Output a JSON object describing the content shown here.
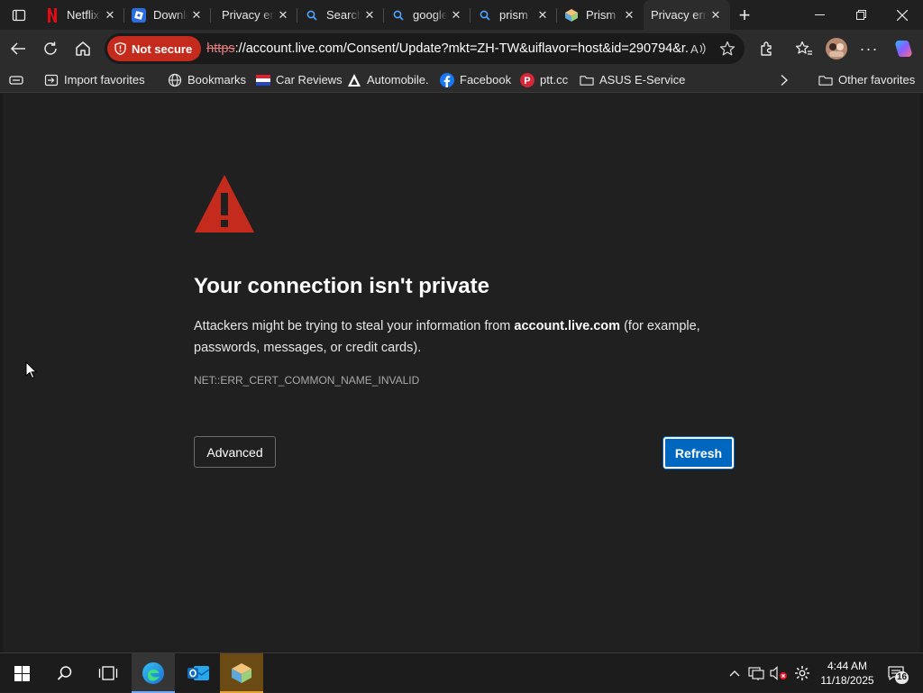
{
  "tabs": [
    {
      "title": "Netflix",
      "icon": "netflix-icon"
    },
    {
      "title": "Download",
      "icon": "roblox-icon"
    },
    {
      "title": "Privacy error",
      "icon": "none"
    },
    {
      "title": "Search",
      "icon": "search-icon"
    },
    {
      "title": "google",
      "icon": "search-icon"
    },
    {
      "title": "prism",
      "icon": "search-icon"
    },
    {
      "title": "Prism",
      "icon": "prism-icon"
    },
    {
      "title": "Privacy error",
      "icon": "none",
      "active": true
    }
  ],
  "toolbar": {
    "security_label": "Not secure",
    "url_scheme": "https",
    "url_rest": "://account.live.com/Consent/Update?mkt=ZH-TW&uiflavor=host&id=290794&r..."
  },
  "favorites": {
    "items": [
      {
        "label": "Import favorites",
        "icon": "import-icon"
      },
      {
        "label": "Bookmarks",
        "icon": "globe-icon"
      },
      {
        "label": "Car Reviews",
        "icon": "flag-icon"
      },
      {
        "label": "Automobile.",
        "icon": "automobile-icon"
      },
      {
        "label": "Facebook",
        "icon": "facebook-icon"
      },
      {
        "label": "ptt.cc",
        "icon": "ptt-icon"
      },
      {
        "label": "ASUS E-Service",
        "icon": "folder-icon"
      }
    ],
    "other_label": "Other favorites"
  },
  "page": {
    "heading": "Your connection isn't private",
    "msg_before": "Attackers might be trying to steal your information from ",
    "msg_domain": "account.live.com",
    "msg_after": " (for example, passwords, messages, or credit cards).",
    "error_code": "NET::ERR_CERT_COMMON_NAME_INVALID",
    "advanced_label": "Advanced",
    "refresh_label": "Refresh"
  },
  "colors": {
    "warning_red": "#c42b1c",
    "refresh_blue": "#0067c0"
  },
  "taskbar": {
    "time": "4:44 AM",
    "date": "11/18/2025",
    "notification_count": "16"
  }
}
